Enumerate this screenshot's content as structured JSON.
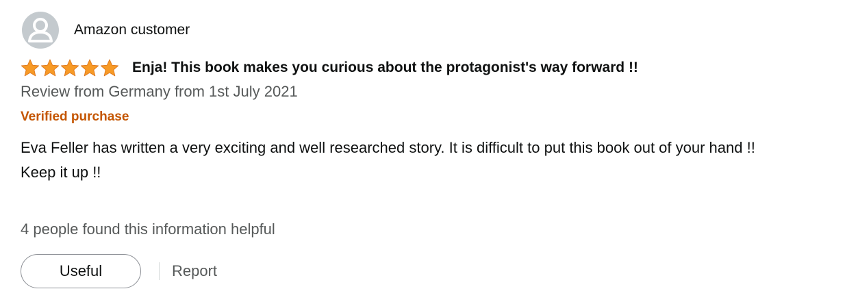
{
  "reviewer": {
    "name": "Amazon customer",
    "avatar_icon": "user-silhouette-icon"
  },
  "rating": {
    "stars_filled": 5,
    "stars_total": 5,
    "star_color": "#f79a26"
  },
  "review": {
    "title": "Enja! This book makes you curious about the protagonist's way forward !!",
    "date_line": "Review from Germany from 1st July 2021",
    "verified_label": "Verified purchase",
    "body_lines": [
      "Eva Feller has written a very exciting and well researched story. It is difficult to put this book out of your hand !!",
      "Keep it up !!"
    ],
    "helpful_text": "4 people found this information helpful"
  },
  "actions": {
    "useful_label": "Useful",
    "report_label": "Report"
  },
  "colors": {
    "verified": "#c45500",
    "secondary_text": "#565959",
    "avatar_bg": "#c4cace"
  }
}
